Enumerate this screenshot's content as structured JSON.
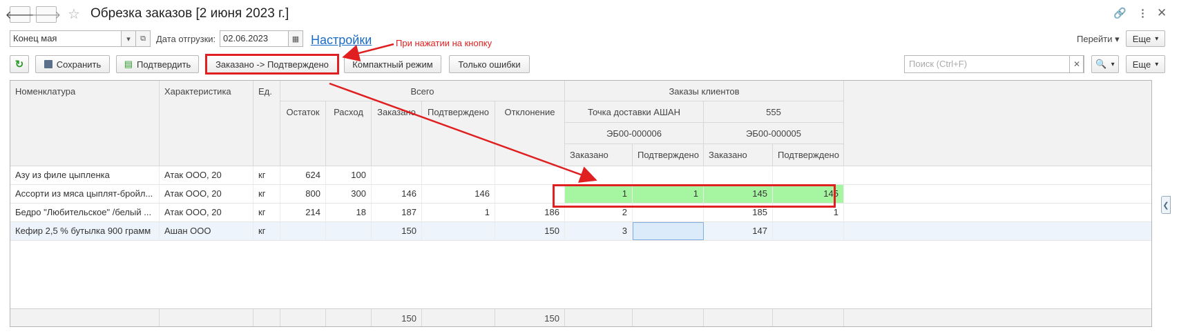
{
  "window": {
    "title": "Обрезка заказов [2 июня 2023 г.]"
  },
  "filter": {
    "period_value": "Конец мая",
    "ship_date_label": "Дата отгрузки:",
    "ship_date_value": "02.06.2023",
    "settings_link": "Настройки",
    "goto_label": "Перейти",
    "more_label": "Еще"
  },
  "annotation": {
    "text": "При нажатии на кнопку"
  },
  "toolbar": {
    "save_label": "Сохранить",
    "confirm_label": "Подтвердить",
    "ordered_to_confirmed_label": "Заказано -> Подтверждено",
    "compact_label": "Компактный режим",
    "errors_only_label": "Только ошибки",
    "search_placeholder": "Поиск (Ctrl+F)",
    "more_label": "Еще"
  },
  "table": {
    "headers": {
      "nomenclature": "Номенклатура",
      "characteristic": "Характеристика",
      "unit": "Ед.",
      "total": "Всего",
      "remaining": "Остаток",
      "consumption": "Расход",
      "ordered": "Заказано",
      "confirmed": "Подтверждено",
      "deviation": "Отклонение",
      "client_orders": "Заказы клиентов",
      "point1": "Точка доставки АШАН",
      "point2": "555",
      "code1": "ЭБ00-000006",
      "code2": "ЭБ00-000005",
      "p1_ordered": "Заказано",
      "p1_confirmed": "Подтверждено",
      "p2_ordered": "Заказано",
      "p2_confirmed": "Подтверждено"
    },
    "rows": [
      {
        "name": "Азу из филе цыпленка",
        "char": "Атак ООО, 20",
        "unit": "кг",
        "remaining": "624",
        "consumption": "100",
        "ordered": "",
        "confirmed": "",
        "deviation": "",
        "p1o": "",
        "p1c": "",
        "p2o": "",
        "p2c": ""
      },
      {
        "name": "Ассорти из мяса цыплят-бройл...",
        "char": "Атак ООО, 20",
        "unit": "кг",
        "remaining": "800",
        "consumption": "300",
        "ordered": "146",
        "confirmed": "146",
        "deviation": "",
        "p1o": "1",
        "p1c": "1",
        "p2o": "145",
        "p2c": "145"
      },
      {
        "name": "Бедро \"Любительское\" /белый ...",
        "char": "Атак ООО, 20",
        "unit": "кг",
        "remaining": "214",
        "consumption": "18",
        "ordered": "187",
        "confirmed": "1",
        "deviation": "186",
        "p1o": "2",
        "p1c": "",
        "p2o": "185",
        "p2c": "1"
      },
      {
        "name": "Кефир 2,5 % бутылка 900 грамм",
        "char": "Ашан ООО",
        "unit": "кг",
        "remaining": "",
        "consumption": "",
        "ordered": "150",
        "confirmed": "",
        "deviation": "150",
        "p1o": "3",
        "p1c": "",
        "p2o": "147",
        "p2c": ""
      }
    ],
    "footer": {
      "ordered": "150",
      "deviation": "150"
    }
  },
  "colors": {
    "highlight_green": "#a6f5a0",
    "annotation_red": "#e02020",
    "link_blue": "#1a6cc6"
  }
}
